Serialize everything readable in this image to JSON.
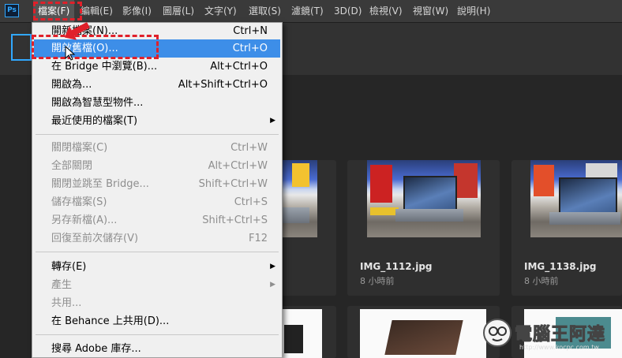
{
  "app": {
    "logo": "Ps"
  },
  "menubar": {
    "items": [
      {
        "label": "檔案(F)",
        "active": true
      },
      {
        "label": "編輯(E)"
      },
      {
        "label": "影像(I)"
      },
      {
        "label": "圖層(L)"
      },
      {
        "label": "文字(Y)"
      },
      {
        "label": "選取(S)"
      },
      {
        "label": "濾鏡(T)"
      },
      {
        "label": "3D(D)"
      },
      {
        "label": "檢視(V)"
      },
      {
        "label": "視窗(W)"
      },
      {
        "label": "說明(H)"
      }
    ]
  },
  "file_menu": {
    "items": [
      {
        "label": "開新檔案(N)...",
        "shortcut": "Ctrl+N"
      },
      {
        "label": "開啟舊檔(O)...",
        "shortcut": "Ctrl+O",
        "highlighted": true
      },
      {
        "label": "在 Bridge 中瀏覽(B)...",
        "shortcut": "Alt+Ctrl+O"
      },
      {
        "label": "開啟為...",
        "shortcut": "Alt+Shift+Ctrl+O"
      },
      {
        "label": "開啟為智慧型物件..."
      },
      {
        "label": "最近使用的檔案(T)",
        "submenu": true
      },
      {
        "label": "關閉檔案(C)",
        "shortcut": "Ctrl+W",
        "disabled": true
      },
      {
        "label": "全部關閉",
        "shortcut": "Alt+Ctrl+W",
        "disabled": true
      },
      {
        "label": "關閉並跳至 Bridge...",
        "shortcut": "Shift+Ctrl+W",
        "disabled": true
      },
      {
        "label": "儲存檔案(S)",
        "shortcut": "Ctrl+S",
        "disabled": true
      },
      {
        "label": "另存新檔(A)...",
        "shortcut": "Shift+Ctrl+S",
        "disabled": true
      },
      {
        "label": "回復至前次儲存(V)",
        "shortcut": "F12",
        "disabled": true
      },
      {
        "label": "轉存(E)",
        "submenu": true
      },
      {
        "label": "產生",
        "submenu": true,
        "disabled": true
      },
      {
        "label": "共用...",
        "disabled": true
      },
      {
        "label": "在 Behance 上共用(D)..."
      },
      {
        "label": "搜尋 Adobe 庫存..."
      }
    ]
  },
  "recent_files": [
    {
      "name": "IMG_1112.jpg",
      "time": "8 小時前"
    },
    {
      "name": "IMG_1138.jpg",
      "time": "8 小時前"
    }
  ],
  "watermark": {
    "text": "電腦王阿達",
    "url": "http://www.kocpc.com.tw"
  },
  "colors": {
    "highlight": "#3d8ee8",
    "annotation": "#e0202a",
    "accent": "#31a8ff"
  }
}
